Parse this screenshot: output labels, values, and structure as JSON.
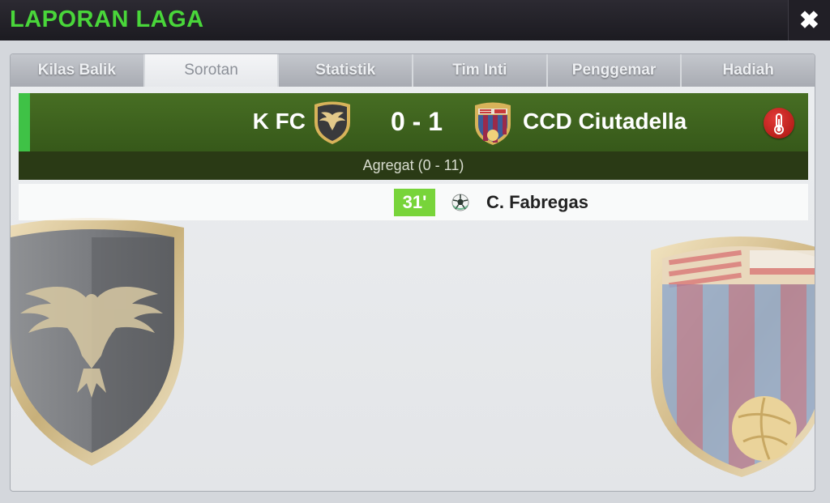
{
  "window": {
    "title": "LAPORAN LAGA",
    "close_icon": "close-icon"
  },
  "tabs": [
    {
      "label": "Kilas Balik",
      "active": false
    },
    {
      "label": "Sorotan",
      "active": true
    },
    {
      "label": "Statistik",
      "active": false
    },
    {
      "label": "Tim Inti",
      "active": false
    },
    {
      "label": "Penggemar",
      "active": false
    },
    {
      "label": "Hadiah",
      "active": false
    }
  ],
  "match": {
    "home_team": "K FC",
    "home_badge": "eagle-crest-icon",
    "score": "0 - 1",
    "away_team": "CCD Ciutadella",
    "away_badge": "striped-crest-icon",
    "aggregate": "Agregat (0 - 11)",
    "weather_icon": "thermometer-icon"
  },
  "events": [
    {
      "minute": "31'",
      "icon": "football-icon",
      "player": "C. Fabregas"
    }
  ],
  "colors": {
    "title": "#49d63a",
    "pitch": "#3f6a1f",
    "accent": "#3fc246",
    "minute_badge": "#78d43a",
    "alert": "#c4201c"
  }
}
